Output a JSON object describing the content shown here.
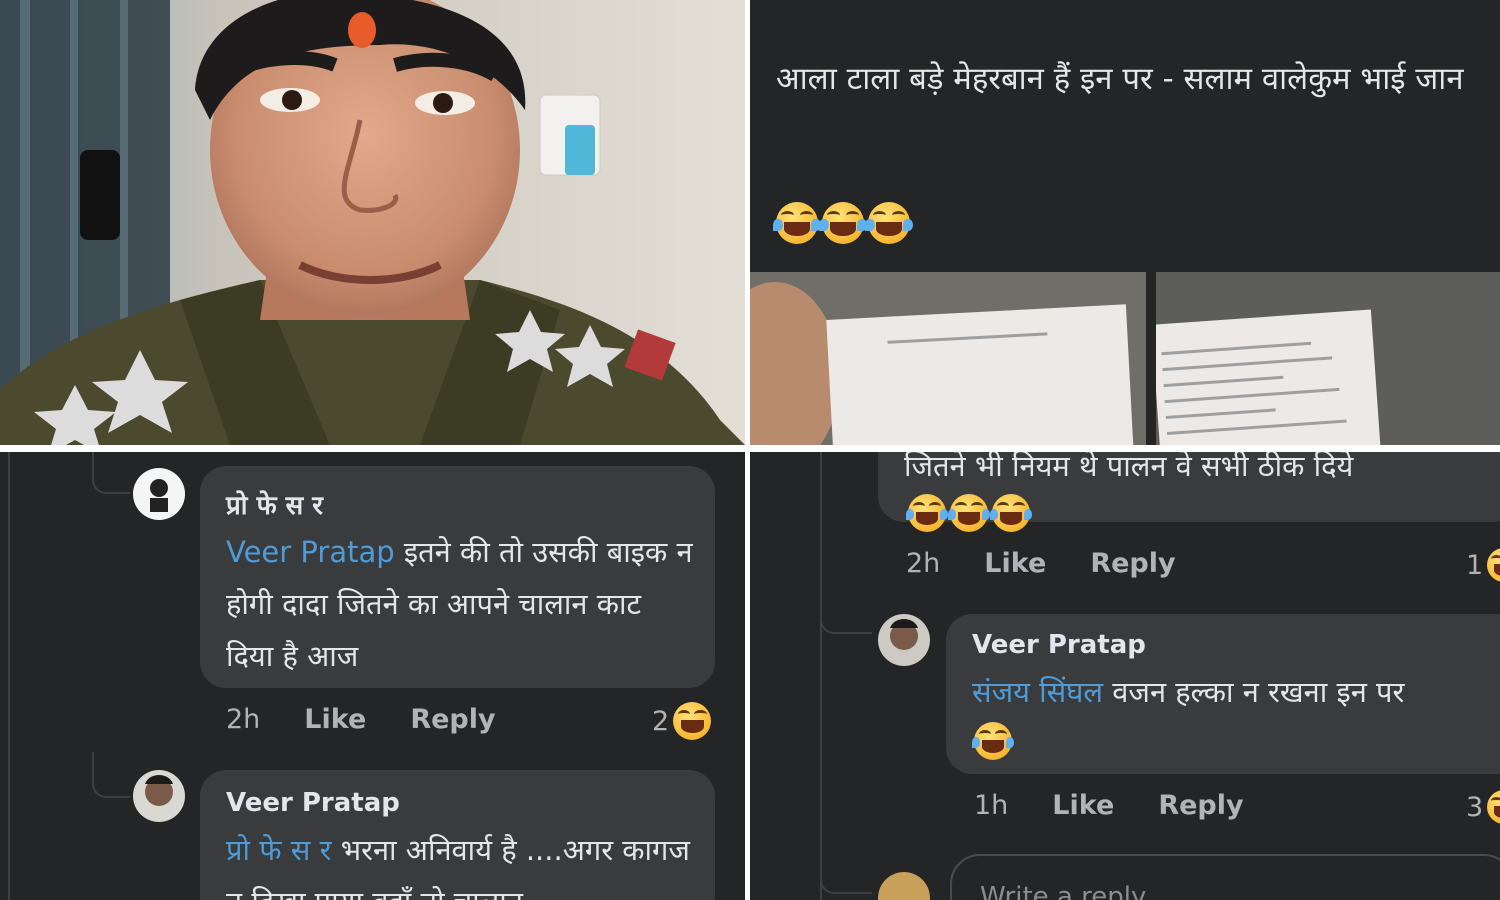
{
  "post": {
    "text": "आला टाला बड़े मेहरबान हैं इन पर - सलाम वालेकुम भाई जान",
    "emojis": [
      "laughing-crying-emoji",
      "laughing-crying-emoji",
      "laughing-crying-emoji"
    ]
  },
  "left_thread": {
    "comment1": {
      "author": "प्रो फे स र",
      "mention": "Veer Pratap",
      "text": " इतने की तो उसकी बाइक न होगी दादा जितने का आपने चालान काट दिया है आज",
      "time": "2h",
      "like": "Like",
      "reply": "Reply",
      "reaction_count": "2"
    },
    "comment2": {
      "author": "Veer Pratap",
      "mention": "प्रो फे स र",
      "text": " भरना अनिवार्य है ....अगर कागज न दिखा पाया वहाँ तो चालान"
    }
  },
  "right_thread": {
    "partial_text": "जितने भी नियम थे पालन वे सभी ठीक दिये",
    "comment1": {
      "time": "2h",
      "like": "Like",
      "reply": "Reply",
      "reaction_count": "1"
    },
    "comment2": {
      "author": "Veer Pratap",
      "mention": "संजय सिंघल",
      "text": " वजन हल्का न रखना इन पर",
      "time": "1h",
      "like": "Like",
      "reply": "Reply",
      "reaction_count": "3"
    },
    "reply_placeholder": "Write a reply..."
  },
  "colors": {
    "panel_bg": "#242526",
    "bubble_bg": "#3a3b3c",
    "mention": "#4e9bd8",
    "text": "#e4e6eb",
    "muted": "#b0b3b8"
  }
}
